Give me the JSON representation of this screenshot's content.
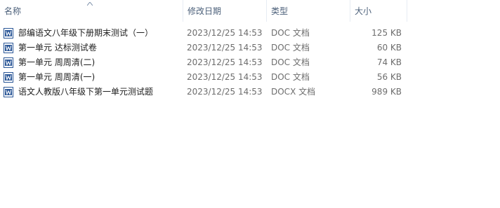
{
  "columns": {
    "name": "名称",
    "date": "修改日期",
    "type": "类型",
    "size": "大小"
  },
  "files": [
    {
      "name": "部编语文八年级下册期末测试（一）",
      "date": "2023/12/25 14:53",
      "type": "DOC 文档",
      "size": "125 KB",
      "icon": "word-doc-icon"
    },
    {
      "name": "第一单元 达标测试卷",
      "date": "2023/12/25 14:53",
      "type": "DOC 文档",
      "size": "60 KB",
      "icon": "word-doc-icon"
    },
    {
      "name": "第一单元 周周清(二)",
      "date": "2023/12/25 14:53",
      "type": "DOC 文档",
      "size": "74 KB",
      "icon": "word-doc-icon"
    },
    {
      "name": "第一单元 周周清(一)",
      "date": "2023/12/25 14:53",
      "type": "DOC 文档",
      "size": "56 KB",
      "icon": "word-doc-icon"
    },
    {
      "name": "语文人教版八年级下第一单元测试题",
      "date": "2023/12/25 14:53",
      "type": "DOCX 文档",
      "size": "989 KB",
      "icon": "word-doc-icon"
    }
  ],
  "colors": {
    "header_text": "#4c607a",
    "icon_blue": "#2b5797",
    "meta_text": "#6d6d6d"
  }
}
